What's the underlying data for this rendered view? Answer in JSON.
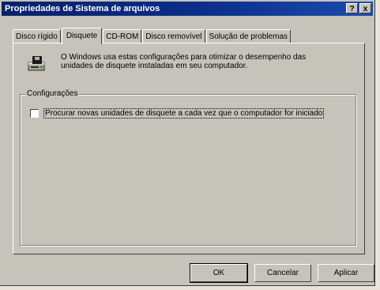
{
  "window": {
    "title": "Propriedades de Sistema de arquivos",
    "help_label": "?",
    "close_label": "x"
  },
  "tabs": [
    {
      "label": "Disco rígido",
      "active": false
    },
    {
      "label": "Disquete",
      "active": true
    },
    {
      "label": "CD-ROM",
      "active": false
    },
    {
      "label": "Disco removível",
      "active": false
    },
    {
      "label": "Solução de problemas",
      "active": false
    }
  ],
  "panel": {
    "icon": "floppy-drive-icon",
    "description": "O Windows usa estas configurações para otimizar o desempenho das unidades de disquete instaladas em seu computador.",
    "group_label": "Configurações",
    "checkbox_label": "Procurar novas unidades de disquete a cada vez que o computador for iniciado",
    "checkbox_checked": false
  },
  "buttons": {
    "ok": "OK",
    "cancel": "Cancelar",
    "apply": "Aplicar"
  },
  "colors": {
    "titlebar": "#08216b",
    "face": "#c6c3bb"
  }
}
